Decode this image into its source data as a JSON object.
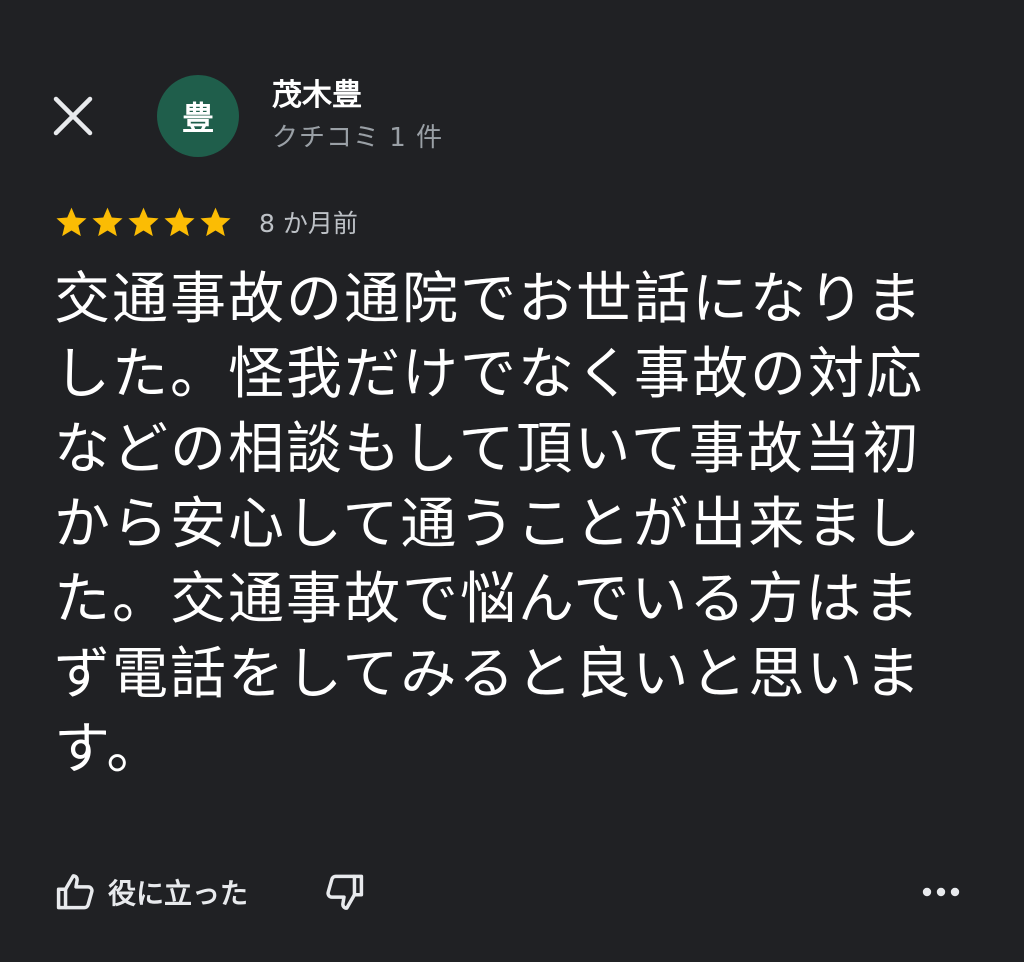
{
  "reviewer": {
    "avatar_letter": "豊",
    "avatar_color": "#1f5e4b",
    "name": "茂木豊",
    "review_count": "クチコミ 1 件"
  },
  "review": {
    "rating": 5,
    "max_rating": 5,
    "star_color": "#fbbc04",
    "date": "8 か月前",
    "text": "交通事故の通院でお世話になりました。怪我だけでなく事故の対応などの相談もして頂いて事故当初から安心して通うことが出来ました。交通事故で悩んでいる方はまず電話をしてみると良いと思います。"
  },
  "actions": {
    "helpful_label": "役に立った",
    "icons": [
      "close-icon",
      "thumbs-up-icon",
      "thumbs-down-icon",
      "more-horiz-icon",
      "star-icon"
    ]
  },
  "theme": {
    "background": "#202124",
    "primary_text": "#ffffff",
    "secondary_text": "#9aa0a6"
  }
}
